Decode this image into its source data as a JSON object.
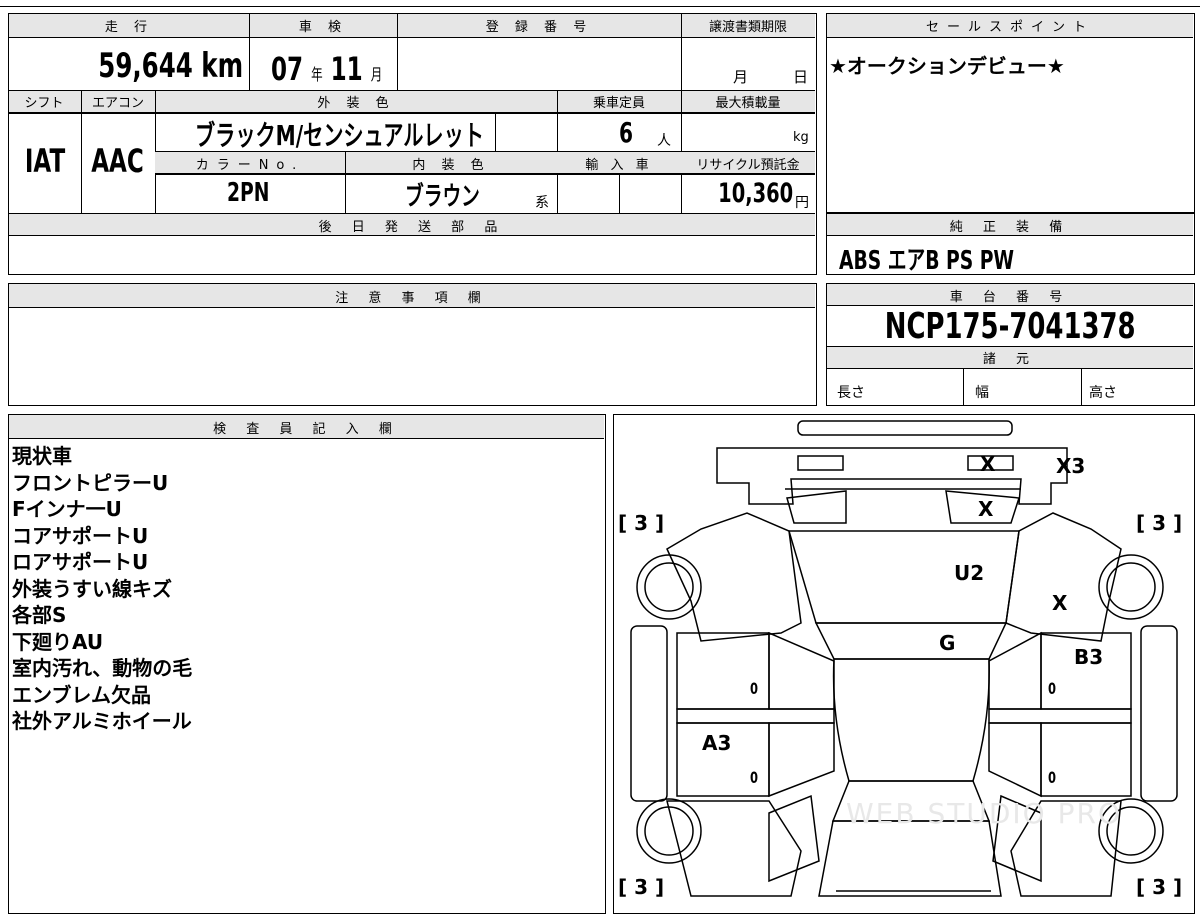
{
  "left_top": {
    "headers": {
      "mileage": "走 行",
      "inspection": "車 検",
      "registration": "登 録 番 号",
      "transfer_deadline": "譲渡書類期限",
      "shift": "シフト",
      "aircon": "エアコン",
      "exterior_color": "外 装 色",
      "capacity": "乗車定員",
      "max_load": "最大積載量",
      "color_no": "カラーNo.",
      "interior_color": "内 装 色",
      "import": "輸 入 車",
      "recycle_fee": "リサイクル預託金",
      "later_parts": "後 日 発 送 部 品"
    },
    "mileage_value": "59,644",
    "mileage_unit": "km",
    "inspection_year": "07",
    "year_unit": "年",
    "inspection_month": "11",
    "month_unit": "月",
    "deadline_month_unit": "月",
    "deadline_day_unit": "日",
    "shift_value": "IAT",
    "aircon_value": "AAC",
    "exterior_color_value": "ブラックM/センシュアルレット",
    "capacity_value": "6",
    "capacity_unit": "人",
    "max_load_unit": "kg",
    "color_no_value": "2PN",
    "interior_color_value": "ブラウン",
    "interior_color_suffix": "系",
    "recycle_value": "10,360",
    "recycle_unit": "円"
  },
  "sales_point": {
    "header": "セールスポイント",
    "text": "★オークションデビュー★"
  },
  "genuine_equipment": {
    "header": "純 正 装 備",
    "value": "ABS エアB PS PW"
  },
  "caution": {
    "header": "注 意 事 項 欄"
  },
  "chassis": {
    "header": "車 台 番 号",
    "value": "NCP175-7041378",
    "spec_header": "諸 元",
    "length": "長さ",
    "width": "幅",
    "height": "高さ"
  },
  "inspector": {
    "header": "検 査 員 記 入 欄",
    "notes": [
      "現状車",
      "フロントピラーU",
      "Fインナ一U",
      "コアサポートU",
      "ロアサポートU",
      "外装うすい線キズ",
      "各部S",
      "下廻りAU",
      "室内汚れ、動物の毛",
      "エンブレム欠品",
      "社外アルミホイール"
    ]
  },
  "diagram": {
    "marks": {
      "grille_x": "X",
      "x3": "X3",
      "hood_x": "X",
      "hood_u2": "U2",
      "fender_x": "X",
      "glass_g": "G",
      "door_b3": "B3",
      "door_a3": "A3"
    },
    "zeros": [
      "0",
      "0",
      "0",
      "0"
    ],
    "tires": [
      "[ 3 ]",
      "[ 3 ]",
      "[ 3 ]",
      "[ 3 ]"
    ],
    "watermark": "WEB STUDIO PRO"
  }
}
